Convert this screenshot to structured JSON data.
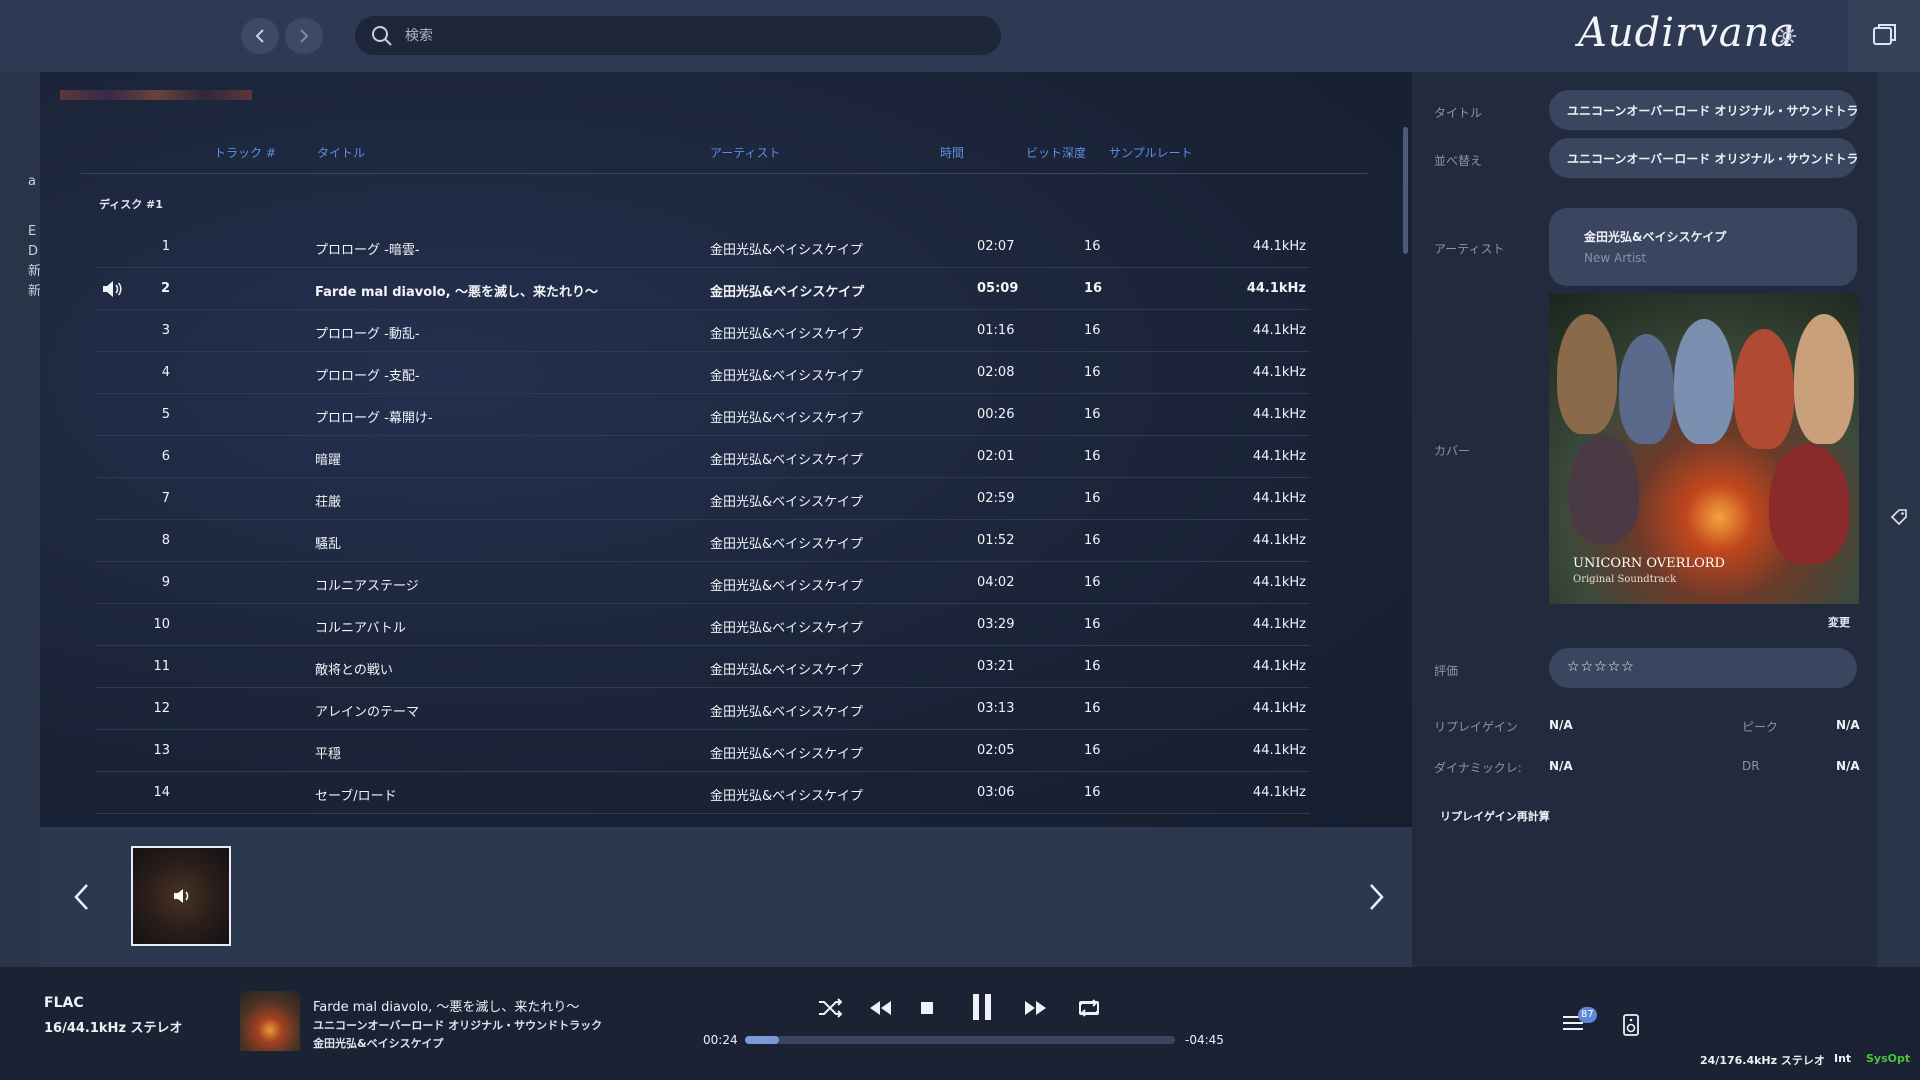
{
  "app": {
    "brand": "Audirvana"
  },
  "toolbar": {
    "back_icon": "chevron-left-icon",
    "forward_icon": "chevron-right-icon",
    "search_placeholder": "検索"
  },
  "columns": {
    "track": "トラック #",
    "title": "タイトル",
    "artist": "アーティスト",
    "time": "時間",
    "bits": "ビット深度",
    "rate": "サンプルレート"
  },
  "disc_label": "ディスク #1",
  "left_strip_chars": [
    "a",
    "E",
    "D",
    "新",
    "新"
  ],
  "tracks": [
    {
      "num": "1",
      "title": "プロローグ -暗雲-",
      "artist": "金田光弘&ベイシスケイプ",
      "time": "02:07",
      "bits": "16",
      "rate": "44.1kHz",
      "playing": false
    },
    {
      "num": "2",
      "title": "Farde mal diavolo, 〜悪を滅し、来たれり〜",
      "artist": "金田光弘&ベイシスケイプ",
      "time": "05:09",
      "bits": "16",
      "rate": "44.1kHz",
      "playing": true
    },
    {
      "num": "3",
      "title": "プロローグ -動乱-",
      "artist": "金田光弘&ベイシスケイプ",
      "time": "01:16",
      "bits": "16",
      "rate": "44.1kHz",
      "playing": false
    },
    {
      "num": "4",
      "title": "プロローグ -支配-",
      "artist": "金田光弘&ベイシスケイプ",
      "time": "02:08",
      "bits": "16",
      "rate": "44.1kHz",
      "playing": false
    },
    {
      "num": "5",
      "title": "プロローグ -幕開け-",
      "artist": "金田光弘&ベイシスケイプ",
      "time": "00:26",
      "bits": "16",
      "rate": "44.1kHz",
      "playing": false
    },
    {
      "num": "6",
      "title": "暗躍",
      "artist": "金田光弘&ベイシスケイプ",
      "time": "02:01",
      "bits": "16",
      "rate": "44.1kHz",
      "playing": false
    },
    {
      "num": "7",
      "title": "荘厳",
      "artist": "金田光弘&ベイシスケイプ",
      "time": "02:59",
      "bits": "16",
      "rate": "44.1kHz",
      "playing": false
    },
    {
      "num": "8",
      "title": "騒乱",
      "artist": "金田光弘&ベイシスケイプ",
      "time": "01:52",
      "bits": "16",
      "rate": "44.1kHz",
      "playing": false
    },
    {
      "num": "9",
      "title": "コルニアステージ",
      "artist": "金田光弘&ベイシスケイプ",
      "time": "04:02",
      "bits": "16",
      "rate": "44.1kHz",
      "playing": false
    },
    {
      "num": "10",
      "title": "コルニアバトル",
      "artist": "金田光弘&ベイシスケイプ",
      "time": "03:29",
      "bits": "16",
      "rate": "44.1kHz",
      "playing": false
    },
    {
      "num": "11",
      "title": "敵将との戦い",
      "artist": "金田光弘&ベイシスケイプ",
      "time": "03:21",
      "bits": "16",
      "rate": "44.1kHz",
      "playing": false
    },
    {
      "num": "12",
      "title": "アレインのテーマ",
      "artist": "金田光弘&ベイシスケイプ",
      "time": "03:13",
      "bits": "16",
      "rate": "44.1kHz",
      "playing": false
    },
    {
      "num": "13",
      "title": "平穏",
      "artist": "金田光弘&ベイシスケイプ",
      "time": "02:05",
      "bits": "16",
      "rate": "44.1kHz",
      "playing": false
    },
    {
      "num": "14",
      "title": "セーブ/ロード",
      "artist": "金田光弘&ベイシスケイプ",
      "time": "03:06",
      "bits": "16",
      "rate": "44.1kHz",
      "playing": false
    }
  ],
  "info": {
    "title_label": "タイトル",
    "title_value": "ユニコーンオーバーロード オリジナル・サウンドトラック",
    "sort_label": "並べ替え",
    "sort_value": "ユニコーンオーバーロード オリジナル・サウンドトラック",
    "artist_label": "アーティスト",
    "artist_value": "金田光弘&ベイシスケイプ",
    "artist_placeholder": "New Artist",
    "cover_label": "カバー",
    "cover_title": "UNICORN OVERLORD",
    "cover_subtitle": "Original Soundtrack",
    "change_label": "変更",
    "rating_label": "評価",
    "rating_value": "☆☆☆☆☆",
    "replaygain_label": "リプレイゲイン",
    "replaygain_value": "N/A",
    "peak_label": "ピーク",
    "peak_value": "N/A",
    "dynamic_label": "ダイナミックレ:",
    "dynamic_value": "N/A",
    "dr_label": "DR",
    "dr_value": "N/A",
    "recalc_label": "リプレイゲイン再計算"
  },
  "player": {
    "format": "FLAC",
    "format_detail": "16/44.1kHz ステレオ",
    "track_title": "Farde mal diavolo, 〜悪を滅し、来たれり〜",
    "album": "ユニコーンオーバーロード オリジナル・サウンドトラック",
    "artist": "金田光弘&ベイシスケイプ",
    "elapsed": "00:24",
    "remaining": "-04:45",
    "progress_fraction": 0.078,
    "queue_count": "87",
    "output_format": "24/176.4kHz ステレオ",
    "output_mode": "Int",
    "output_sysopt": "SysOpt",
    "sysopt_color": "#49c443"
  },
  "colors": {
    "accent": "#5e8fe0",
    "background": "#252f45",
    "panel": "#222b3e",
    "bottombar": "#1a2233"
  }
}
